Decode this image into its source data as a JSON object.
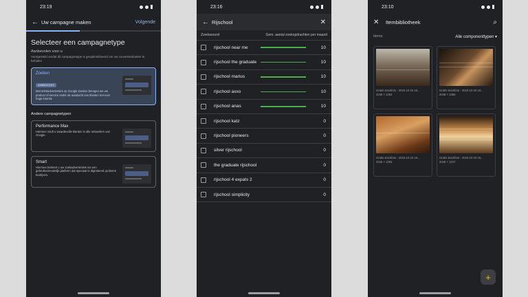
{
  "phone1": {
    "time": "23:19",
    "appbar": {
      "title": "Uw campagne maken",
      "action": "Volgende"
    },
    "progress_fraction": 0.4,
    "heading": "Selecteer een campagnetype",
    "recommended_label": "Aanbevolen voor u",
    "recommended_desc": "Voorgesteld omdat dit campagnetype is geoptimaliseerd om uw conversiedoelen te behalen",
    "selected_card": {
      "title": "Zoeken",
      "badge": "AANBEVOLEN",
      "desc": "Met tekstadvertenties op Google Zoeken brengen we uw product of service onder de aandacht van klanten met een hoge intentie"
    },
    "other_label": "Andere campagnetypen",
    "cards": [
      {
        "title": "Performance Max",
        "desc": "Hiermee vindt u waardevolle klanten in alle netwerken van Google."
      },
      {
        "title": "Smart",
        "desc": "Hiermee beheert u uw zoekadvertenties via een gebruiksvriendelijk platform dat speciaal is afgestemd op kleine bedrijven."
      }
    ]
  },
  "phone2": {
    "time": "23:16",
    "search_value": "Rijschool",
    "col_keyword": "Zoekwoord",
    "col_volume": "Gem. aantal zoekopdrachten per maand",
    "rows": [
      {
        "kw": "rijschool near me",
        "val": "10",
        "bar": true
      },
      {
        "kw": "rijschool the graduate",
        "val": "10",
        "bar": true
      },
      {
        "kw": "rijschool marius",
        "val": "10",
        "bar": true
      },
      {
        "kw": "rijschool axxo",
        "val": "10",
        "bar": true
      },
      {
        "kw": "rijschool anas",
        "val": "10",
        "bar": true
      },
      {
        "kw": "rijschool katz",
        "val": "0",
        "bar": false
      },
      {
        "kw": "rijschool pioneers",
        "val": "0",
        "bar": false
      },
      {
        "kw": "silver rijschool",
        "val": "0",
        "bar": false
      },
      {
        "kw": "the graduate rijschool",
        "val": "0",
        "bar": false
      },
      {
        "kw": "rijschool 4 expats 2",
        "val": "0",
        "bar": false
      },
      {
        "kw": "rijschool simplicity",
        "val": "0",
        "bar": false
      }
    ]
  },
  "phone3": {
    "time": "23:10",
    "title": "Itembibliotheek",
    "items_label": "Items",
    "filter": "Alle componenttypen",
    "tiles": [
      {
        "cap": "Gratis stockfoto - 2023-10-23 18...",
        "size": "2048 × 1252"
      },
      {
        "cap": "Gratis stockfoto - 2023-10-23 18...",
        "size": "2048 × 1365"
      },
      {
        "cap": "Gratis stockfoto - 2023-10-23 18...",
        "size": "2048 × 1256"
      },
      {
        "cap": "Gratis stockfoto - 2023-10-23 18...",
        "size": "2048 × 1347"
      }
    ]
  },
  "icons": {
    "back": "arrow-left-icon",
    "close": "close-icon",
    "search": "search-icon",
    "add": "add-icon",
    "dropdown": "caret-down-icon"
  },
  "colors": {
    "background": "#202124",
    "accent": "#8ab4f8",
    "bar": "#4caf50",
    "selected_card": "#394457"
  }
}
